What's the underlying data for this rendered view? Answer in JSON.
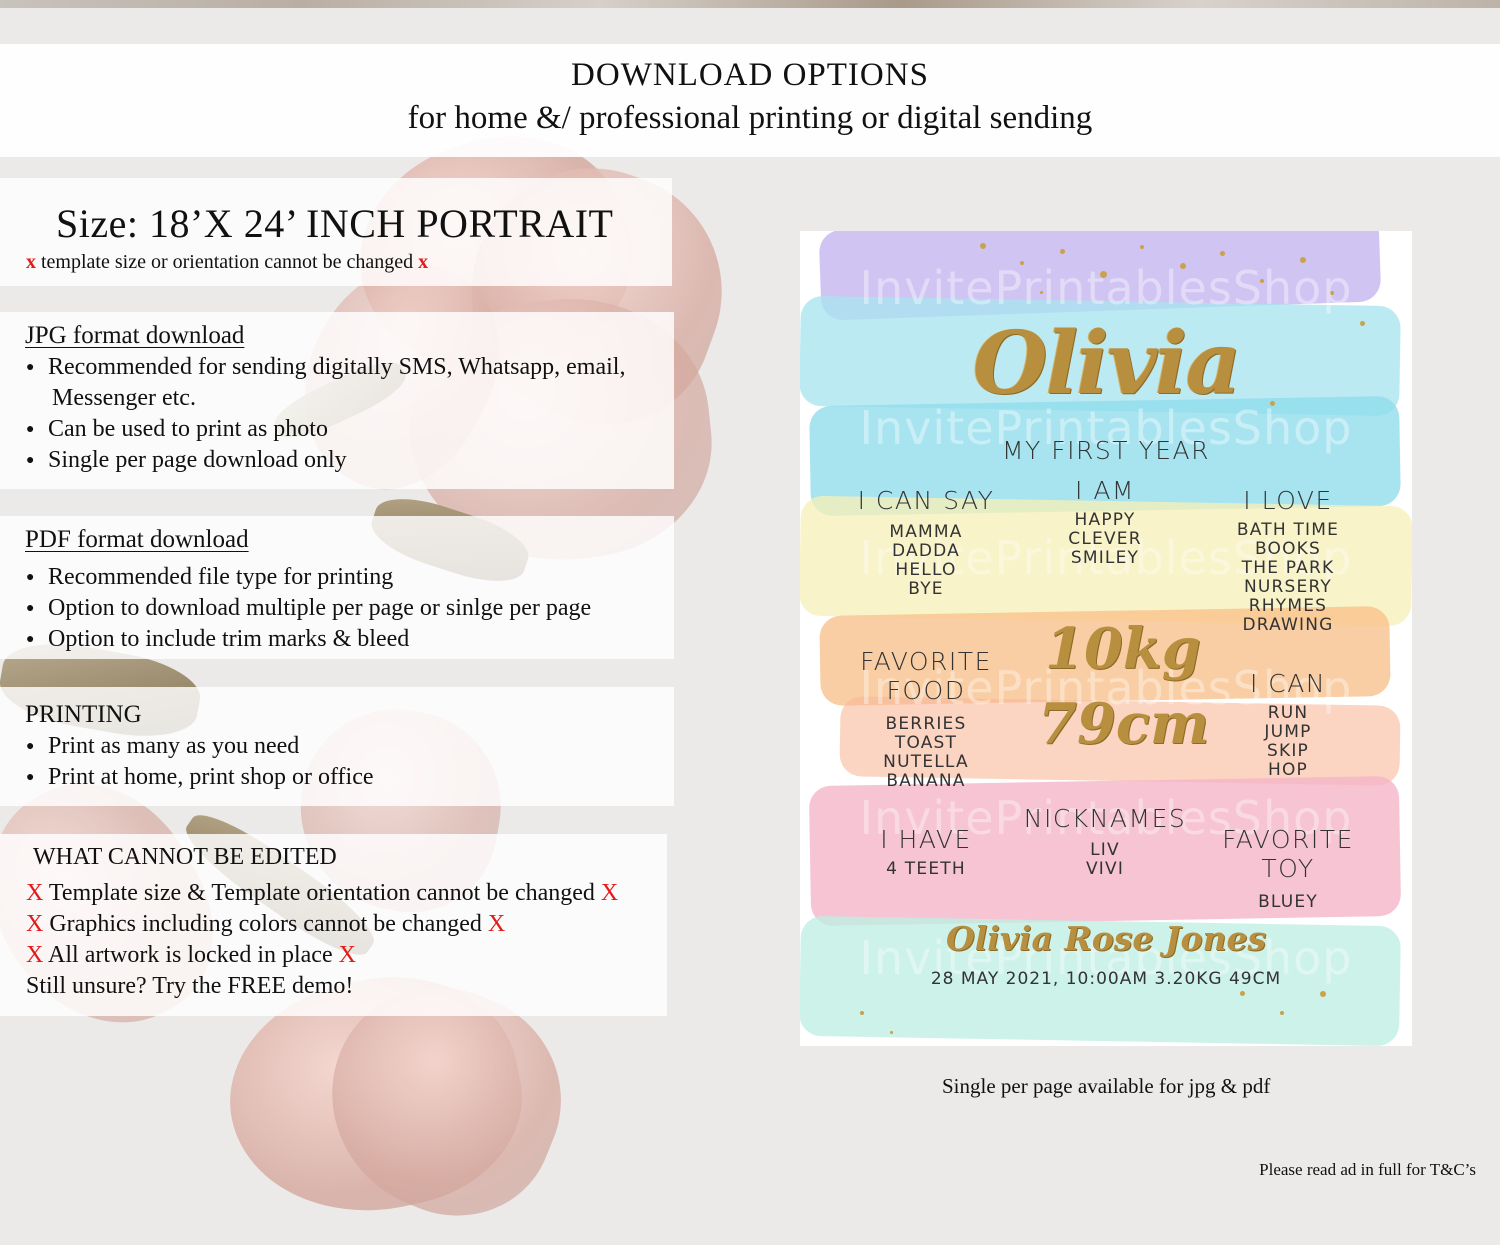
{
  "header": {
    "title": "DOWNLOAD OPTIONS",
    "subtitle": "for home &/ professional printing or digital sending"
  },
  "size": {
    "title": "Size: 18’X 24’ INCH PORTRAIT",
    "x_mark": "x",
    "note": "template size or orientation cannot be changed"
  },
  "jpg": {
    "title": "JPG format download",
    "bullets": [
      "Recommended for sending digitally SMS, Whatsapp, email,",
      "Messenger etc.",
      "Can be used to print as photo",
      "Single per page download only"
    ]
  },
  "pdf": {
    "title": "PDF format download",
    "bullets": [
      "Recommended file type for printing",
      "Option to download multiple per page or sinlge per page",
      "Option to include trim marks & bleed"
    ]
  },
  "printing": {
    "title": "PRINTING",
    "bullets": [
      "Print as many as you need",
      "Print at home, print shop or office"
    ]
  },
  "cannot": {
    "title": "WHAT CANNOT BE EDITED",
    "x_mark": "X",
    "lines": [
      "Template size & Template orientation cannot be changed",
      "Graphics including colors cannot be changed",
      "All artwork is locked in place"
    ],
    "closing": "Still unsure? Try the FREE demo!"
  },
  "poster": {
    "name": "Olivia",
    "subtitle": "MY FIRST YEAR",
    "i_can_say": {
      "heading": "I CAN SAY",
      "items": [
        "MAMMA",
        "DADDA",
        "HELLO",
        "BYE"
      ]
    },
    "i_am": {
      "heading": "I AM",
      "items": [
        "HAPPY",
        "CLEVER",
        "SMILEY"
      ]
    },
    "i_love": {
      "heading": "I LOVE",
      "items": [
        "BATH TIME",
        "BOOKS",
        "THE PARK",
        "NURSERY",
        "RHYMES",
        "DRAWING"
      ]
    },
    "favorite_food": {
      "heading_line1": "FAVORITE",
      "heading_line2": "FOOD",
      "items": [
        "BERRIES",
        "TOAST",
        "NUTELLA",
        "BANANA"
      ]
    },
    "weight": "10kg",
    "height": "79cm",
    "i_can": {
      "heading": "I CAN",
      "items": [
        "RUN",
        "JUMP",
        "SKIP",
        "HOP"
      ]
    },
    "i_have": {
      "heading": "I HAVE",
      "items": [
        "4 TEETH"
      ]
    },
    "nicknames": {
      "heading": "NICKNAMES",
      "items": [
        "LIV",
        "VIVI"
      ]
    },
    "favorite_toy": {
      "heading_line1": "FAVORITE",
      "heading_line2": "TOY",
      "items": [
        "BLUEY"
      ]
    },
    "full_name": "Olivia Rose Jones",
    "birth_details": "28 MAY 2021, 10:00AM 3.20KG 49CM",
    "watermark": "InvitePrintablesShop",
    "colors": {
      "gold": "#b88f3f",
      "lavender": "#c3b4ee",
      "aqua": "#8fdcec",
      "yellow": "#f6f0b8",
      "orange": "#f8c08a",
      "pink": "#f4b3c6",
      "mint": "#bfeee3"
    }
  },
  "caption": "Single per page available for jpg & pdf",
  "footnote": "Please read ad in full for T&C’s",
  "colors": {
    "x_mark": "#e21b1b",
    "panel": "#ffffff",
    "background": "#eceae9"
  }
}
